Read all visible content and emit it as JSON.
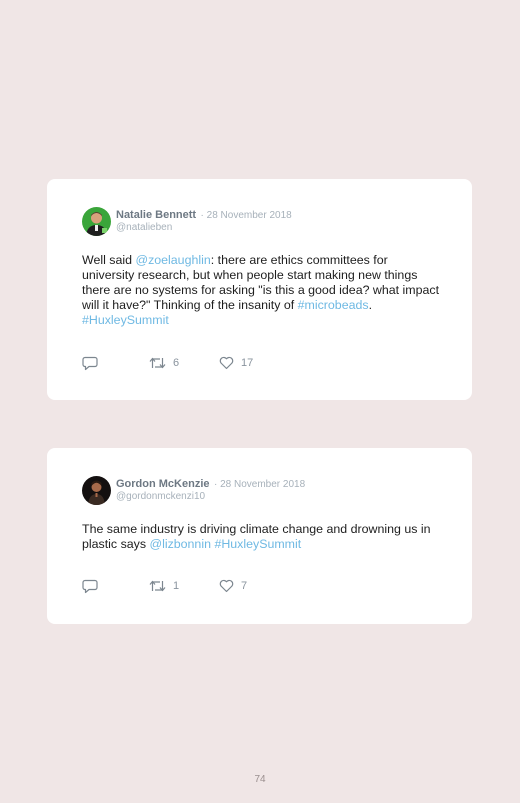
{
  "tweets": [
    {
      "name": "Natalie Bennett",
      "date": "· 28 November 2018",
      "handle": "@natalieben",
      "text_1": "Well said ",
      "mention_1": "@zoelaughlin",
      "text_2": ": there are ethics committees for university research, but when people start making new things there are no systems for asking \"is this a good idea? what impact will it have?\" Thinking of the insanity of ",
      "hashtag_1": "#microbeads",
      "text_3": ". ",
      "hashtag_2": "#HuxleySummit",
      "retweets": "6",
      "likes": "17"
    },
    {
      "name": "Gordon McKenzie",
      "date": "· 28 November 2018",
      "handle": "@gordonmckenzi10",
      "text_1": "The same industry is driving climate change and drowning us in plastic says ",
      "mention_1": "@lizbonnin",
      "text_2": " ",
      "hashtag_1": "#HuxleySummit",
      "retweets": "1",
      "likes": "7"
    }
  ],
  "page_number": "74",
  "colors": {
    "background": "#f0e6e6",
    "card": "#ffffff",
    "link": "#6fb9e3",
    "meta": "#a7b1ba"
  }
}
